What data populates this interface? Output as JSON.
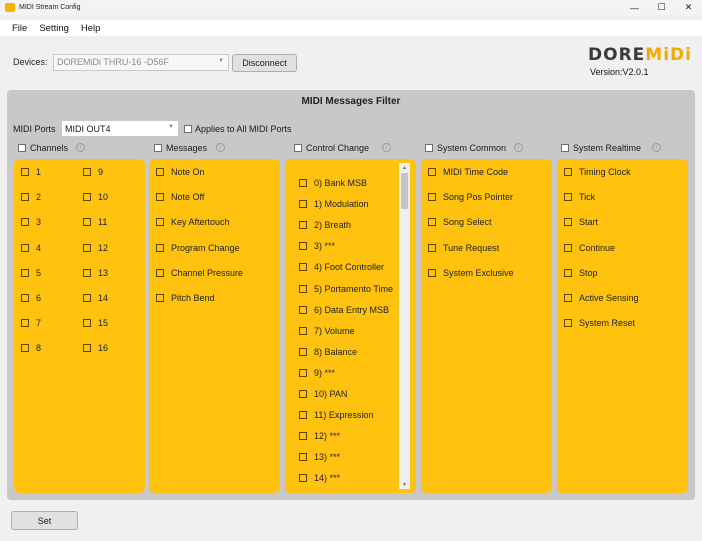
{
  "window": {
    "title": "MIDI Stream Config",
    "minimize": "—",
    "maximize": "☐",
    "close": "✕"
  },
  "menu": [
    "File",
    "Setting",
    "Help"
  ],
  "devices": {
    "label": "Devices:",
    "selected": "DOREMiDi THRU-16 -D56F",
    "disconnect": "Disconnect"
  },
  "brand": {
    "logo_main": "DORE",
    "logo_accent": "MiDi",
    "version": "Version:V2.0.1"
  },
  "filter": {
    "title": "MIDI Messages Filter",
    "ports_label": "MIDI Ports",
    "ports_selected": "MIDI OUT4",
    "applies_all": "Applies to All MIDI Ports"
  },
  "columns": {
    "channels": {
      "header": "Channels",
      "left": [
        "1",
        "2",
        "3",
        "4",
        "5",
        "6",
        "7",
        "8"
      ],
      "right": [
        "9",
        "10",
        "11",
        "12",
        "13",
        "14",
        "15",
        "16"
      ]
    },
    "messages": {
      "header": "Messages",
      "items": [
        "Note On",
        "Note Off",
        "Key Aftertouch",
        "Program Change",
        "Channel Pressure",
        "Pitch Bend"
      ]
    },
    "control_change": {
      "header": "Control Change",
      "items": [
        "0) Bank MSB",
        "1) Modulation",
        "2) Breath",
        "3) ***",
        "4) Foot Controller",
        "5) Portamento Time",
        "6) Data Entry MSB",
        "7) Volume",
        "8) Balance",
        "9) ***",
        "10) PAN",
        "11) Expression",
        "12) ***",
        "13) ***",
        "14) ***"
      ]
    },
    "system_common": {
      "header": "System Common",
      "items": [
        "MIDI Time Code",
        "Song Pos Pointer",
        "Song Select",
        "Tune Request",
        "System Exclusive"
      ]
    },
    "system_realtime": {
      "header": "System Realtime",
      "items": [
        "Timing Clock",
        "Tick",
        "Start",
        "Continue",
        "Stop",
        "Active Sensing",
        "System Reset"
      ]
    }
  },
  "set_button": "Set",
  "colors": {
    "panel": "#ffc20e",
    "panel_bg": "#c8c8c8",
    "logo_accent": "#f2a900"
  }
}
